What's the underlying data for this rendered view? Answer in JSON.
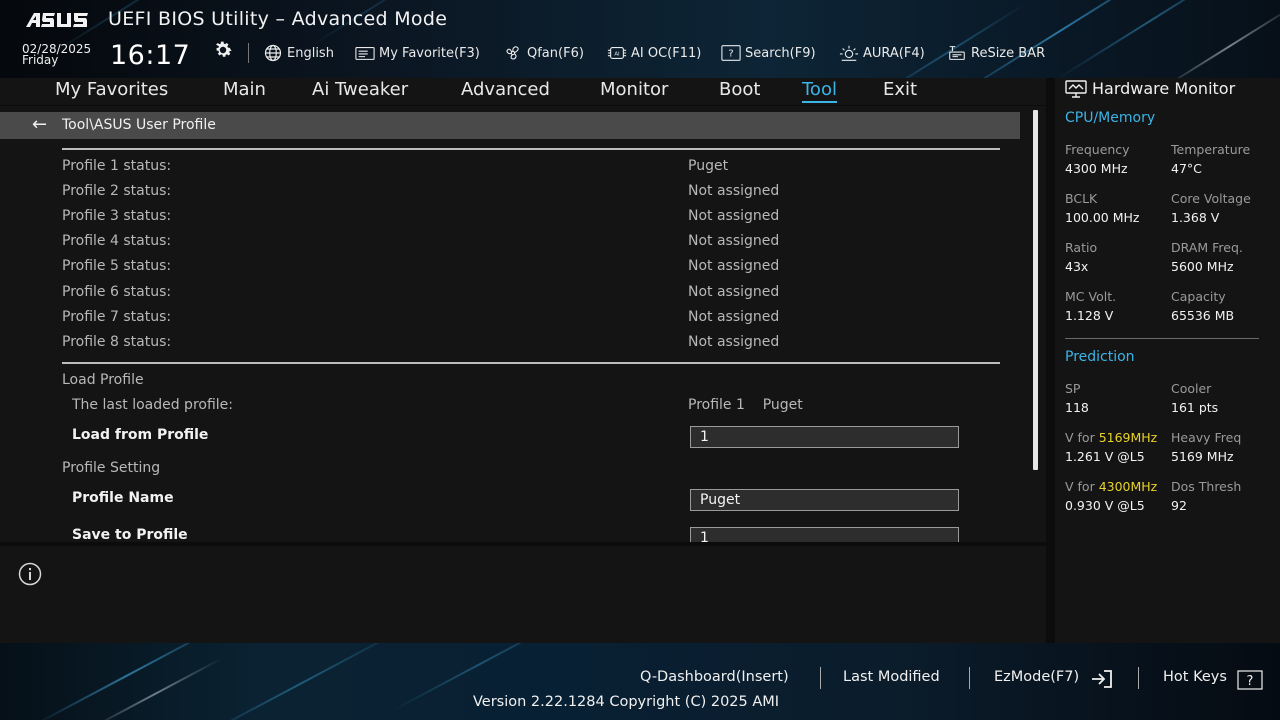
{
  "header": {
    "app_title": "UEFI BIOS Utility – Advanced Mode",
    "date": "02/28/2025",
    "day": "Friday",
    "time": "16:17",
    "tools": [
      {
        "label": "English",
        "icon": "globe-icon"
      },
      {
        "label": "My Favorite(F3)",
        "icon": "favorite-list-icon"
      },
      {
        "label": "Qfan(F6)",
        "icon": "fan-icon"
      },
      {
        "label": "AI OC(F11)",
        "icon": "ai-chip-icon"
      },
      {
        "label": "Search(F9)",
        "icon": "search-icon"
      },
      {
        "label": "AURA(F4)",
        "icon": "aura-icon"
      },
      {
        "label": "ReSize BAR",
        "icon": "resize-bar-icon"
      }
    ]
  },
  "nav": {
    "tabs": [
      "My Favorites",
      "Main",
      "Ai Tweaker",
      "Advanced",
      "Monitor",
      "Boot",
      "Tool",
      "Exit"
    ],
    "active": "Tool"
  },
  "main": {
    "breadcrumb": "Tool\\ASUS User Profile",
    "profiles": [
      {
        "label": "Profile 1 status:",
        "value": "Puget"
      },
      {
        "label": "Profile 2 status:",
        "value": "Not assigned"
      },
      {
        "label": "Profile 3 status:",
        "value": "Not assigned"
      },
      {
        "label": "Profile 4 status:",
        "value": "Not assigned"
      },
      {
        "label": "Profile 5 status:",
        "value": "Not assigned"
      },
      {
        "label": "Profile 6 status:",
        "value": "Not assigned"
      },
      {
        "label": "Profile 7 status:",
        "value": "Not assigned"
      },
      {
        "label": "Profile 8 status:",
        "value": "Not assigned"
      }
    ],
    "load_section": "Load Profile",
    "last_loaded_label": "The last loaded profile:",
    "last_loaded_value": "Profile 1    Puget",
    "load_from_label": "Load from Profile",
    "load_from_value": "1",
    "setting_section": "Profile Setting",
    "profile_name_label": "Profile Name",
    "profile_name_value": "Puget",
    "save_to_label": "Save to Profile",
    "save_to_value": "1"
  },
  "hw": {
    "title": "Hardware Monitor",
    "cpu_section": "CPU/Memory",
    "cpu": [
      {
        "k1": "Frequency",
        "v1": "4300 MHz",
        "k2": "Temperature",
        "v2": "47°C"
      },
      {
        "k1": "BCLK",
        "v1": "100.00 MHz",
        "k2": "Core Voltage",
        "v2": "1.368 V"
      },
      {
        "k1": "Ratio",
        "v1": "43x",
        "k2": "DRAM Freq.",
        "v2": "5600 MHz"
      },
      {
        "k1": "MC Volt.",
        "v1": "1.128 V",
        "k2": "Capacity",
        "v2": "65536 MB"
      }
    ],
    "pred_section": "Prediction",
    "pred": [
      {
        "k1": "SP",
        "v1": "118",
        "k2": "Cooler",
        "v2": "161 pts"
      },
      {
        "k1a": "V for ",
        "k1b": "5169MHz",
        "v1": "1.261 V @L5",
        "k2": "Heavy Freq",
        "v2": "5169 MHz"
      },
      {
        "k1a": "V for ",
        "k1b": "4300MHz",
        "v1": "0.930 V @L5",
        "k2": "Dos Thresh",
        "v2": "92"
      }
    ]
  },
  "footer": {
    "qdash": "Q-Dashboard(Insert)",
    "last_modified": "Last Modified",
    "ezmode": "EzMode(F7)",
    "hotkeys": "Hot Keys",
    "version": "Version 2.22.1284 Copyright (C) 2025 AMI"
  },
  "colors": {
    "accent": "#3cb4e6",
    "highlight": "#e8d32a",
    "panel": "#141414"
  }
}
